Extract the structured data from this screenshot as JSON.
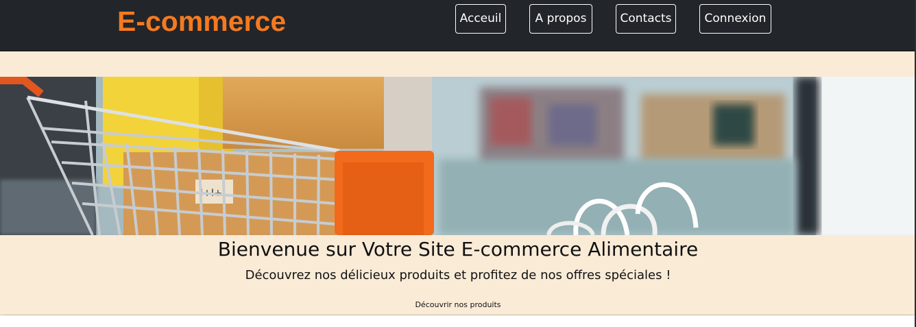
{
  "header": {
    "brand": "E-commerce",
    "nav": [
      {
        "label": "Acceuil"
      },
      {
        "label": "A propos"
      },
      {
        "label": "Contacts"
      },
      {
        "label": "Connexion"
      }
    ]
  },
  "hero": {
    "title": "Bienvenue sur Votre Site E-commerce Alimentaire",
    "subtitle": "Découvrez nos délicieux produits et profitez de nos offres spéciales !",
    "cta": "Découvrir nos produits"
  },
  "colors": {
    "nav_background": "#22252a",
    "brand": "#f47a1f",
    "page_background": "#faebd7"
  }
}
